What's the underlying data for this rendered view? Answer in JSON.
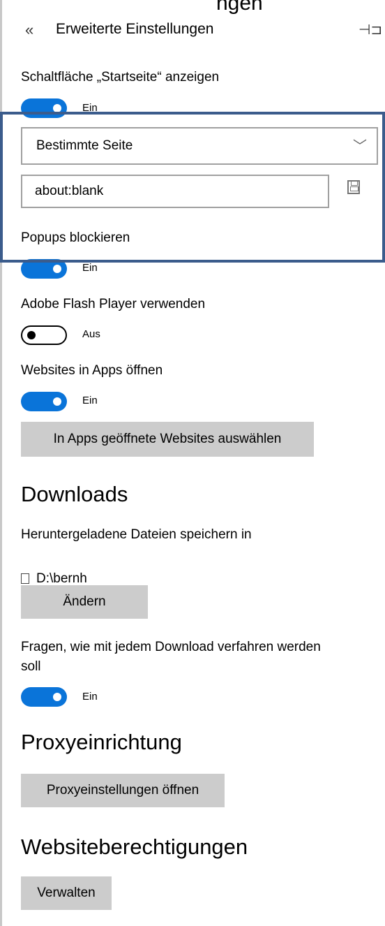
{
  "header": {
    "top_cut_text": "ngen",
    "title": "Erweiterte Einstellungen",
    "back_glyph": "«",
    "pin_glyph": "⊣⊐"
  },
  "home_button": {
    "label": "Schaltfläche „Startseite“ anzeigen",
    "state": "Ein",
    "select_value": "Bestimmte Seite",
    "url_value": "about:blank"
  },
  "popups": {
    "label": "Popups blockieren",
    "state": "Ein"
  },
  "flash": {
    "label": "Adobe Flash Player verwenden",
    "state": "Aus"
  },
  "apps": {
    "label": "Websites in Apps öffnen",
    "state": "Ein",
    "button": "In Apps geöffnete Websites auswählen"
  },
  "downloads": {
    "heading": "Downloads",
    "save_in_label": "Heruntergeladene Dateien speichern in",
    "path": "D:\\bernh",
    "change_button": "Ändern",
    "ask_label_line1": "Fragen, wie mit jedem Download verfahren werden",
    "ask_label_line2": "soll",
    "ask_state": "Ein"
  },
  "proxy": {
    "heading": "Proxyeinrichtung",
    "button": "Proxyeinstellungen öffnen"
  },
  "permissions": {
    "heading": "Websiteberechtigungen",
    "button": "Verwalten"
  },
  "colors": {
    "accent": "#0a74d9",
    "highlight": "#3b5c8c",
    "button_bg": "#cccccc"
  },
  "icons": [
    "back-chevrons-icon",
    "pin-icon",
    "chevron-down-icon",
    "save-icon",
    "folder-icon"
  ]
}
